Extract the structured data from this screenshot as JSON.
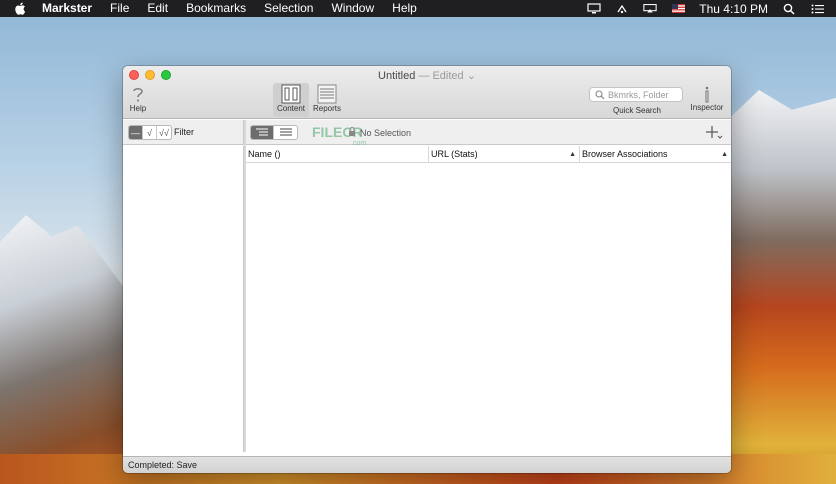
{
  "menubar": {
    "app_name": "Markster",
    "items": [
      "File",
      "Edit",
      "Bookmarks",
      "Selection",
      "Window",
      "Help"
    ],
    "clock": "Thu 4:10 PM"
  },
  "window": {
    "title": "Untitled",
    "edited": "— Edited"
  },
  "toolbar": {
    "help_label": "Help",
    "content_label": "Content",
    "reports_label": "Reports",
    "search_placeholder": "Bkmrks, Folder",
    "search_label": "Quick Search",
    "inspector_label": "Inspector"
  },
  "sidebar": {
    "filter_label": "Filter"
  },
  "main": {
    "selection_text": "No Selection",
    "watermark": "FILECR",
    "watermark_sub": ".com",
    "columns": {
      "name": "Name",
      "name_sort": "()",
      "url": "URL (Stats)",
      "browser": "Browser Associations"
    }
  },
  "status": {
    "text": "Completed: Save"
  }
}
